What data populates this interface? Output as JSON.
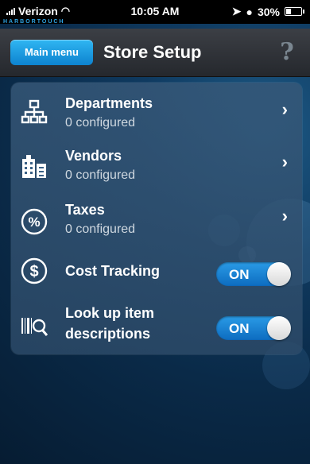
{
  "status_bar": {
    "carrier": "Verizon",
    "time": "10:05 AM",
    "battery": "30%",
    "brand": "HARBORTOUCH"
  },
  "nav": {
    "back_label": "Main menu",
    "title": "Store Setup",
    "help_glyph": "?"
  },
  "items": [
    {
      "icon": "sitemap-icon",
      "title": "Departments",
      "subtitle": "0 configured",
      "accessory": "chevron"
    },
    {
      "icon": "buildings-icon",
      "title": "Vendors",
      "subtitle": "0 configured",
      "accessory": "chevron"
    },
    {
      "icon": "percent-icon",
      "title": "Taxes",
      "subtitle": "0 configured",
      "accessory": "chevron"
    },
    {
      "icon": "dollar-icon",
      "title": "Cost Tracking",
      "accessory": "toggle",
      "toggle_label": "ON"
    },
    {
      "icon": "barcode-search-icon",
      "title_line1": "Look up item",
      "title_line2": "descriptions",
      "accessory": "toggle",
      "toggle_label": "ON"
    }
  ],
  "chevron_glyph": "›",
  "colors": {
    "accent": "#1a8fdc",
    "nav": "#2f3237"
  }
}
